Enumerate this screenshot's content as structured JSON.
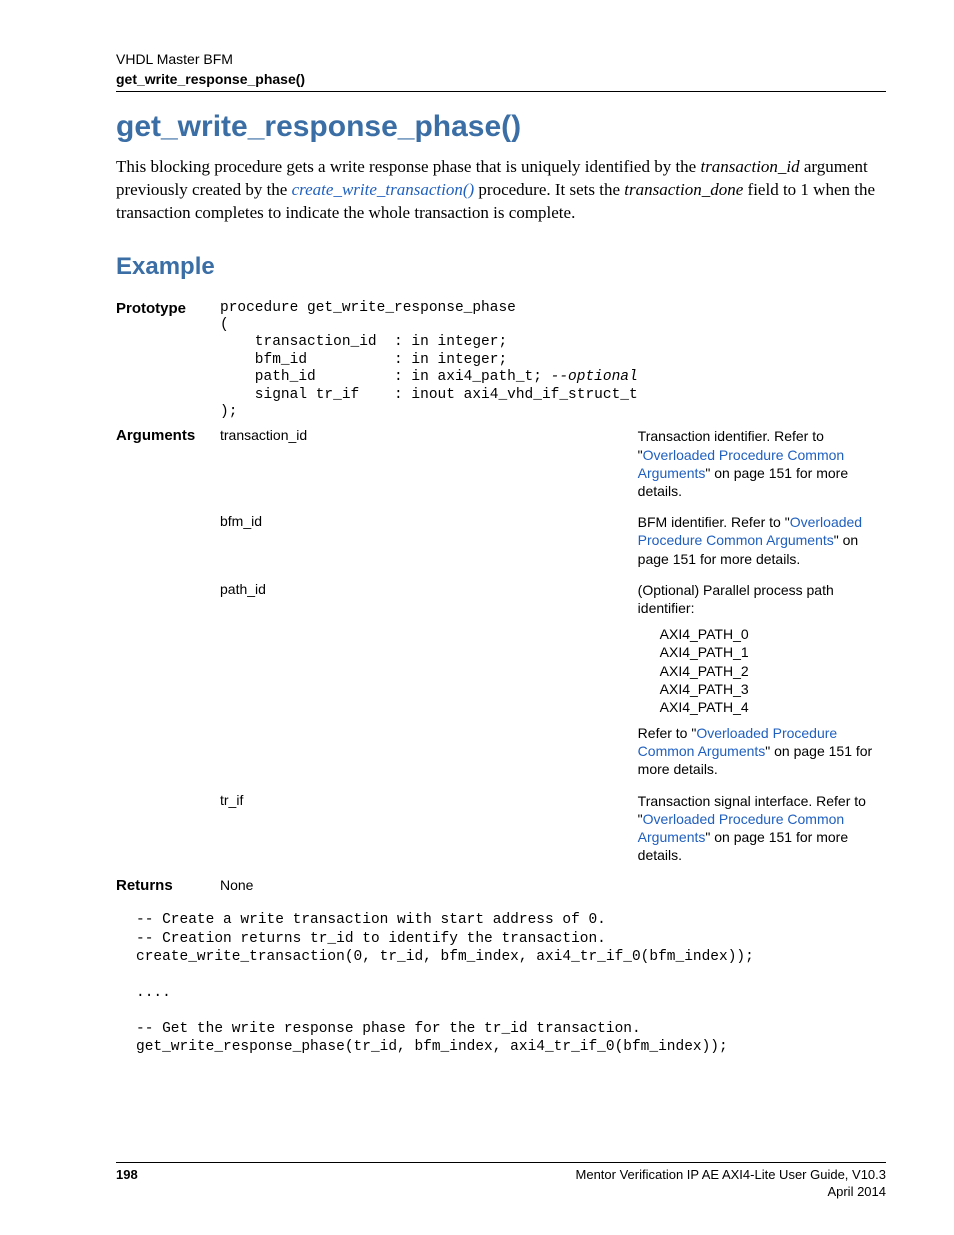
{
  "header": {
    "top": "VHDL Master BFM",
    "sub": "get_write_response_phase()"
  },
  "title": "get_write_response_phase()",
  "intro": {
    "pre": "This blocking procedure gets a write response phase that is uniquely identified by the ",
    "arg_italic": "transaction_id",
    "mid": " argument previously created by the ",
    "link": "create_write_transaction()",
    "post1": " procedure. It sets the ",
    "done_italic": "transaction_done",
    "post2": " field to 1 when the transaction completes to indicate the whole transaction is complete."
  },
  "section_example": "Example",
  "prototype_label": "Prototype",
  "prototype_code": "procedure get_write_response_phase\n(\n    transaction_id  : in integer;\n    bfm_id          : in integer;\n    path_id         : in axi4_path_t; --optional\n    signal tr_if    : inout axi4_vhd_if_struct_t\n);",
  "arguments_label": "Arguments",
  "args": {
    "transaction_id": {
      "name": "transaction_id",
      "pre": "Transaction identifier. Refer to \"",
      "link": "Overloaded Procedure Common Arguments",
      "post": "\" on page 151 for more details."
    },
    "bfm_id": {
      "name": "bfm_id",
      "pre": "BFM identifier. Refer to \"",
      "link": "Overloaded Procedure Common Arguments",
      "post": "\" on page 151 for more details."
    },
    "path_id": {
      "name": "path_id",
      "pre": "(Optional) Parallel process path identifier:",
      "paths": [
        "AXI4_PATH_0",
        "AXI4_PATH_1",
        "AXI4_PATH_2",
        "AXI4_PATH_3",
        "AXI4_PATH_4"
      ],
      "refer_pre": "Refer to \"",
      "refer_link": "Overloaded Procedure Common Arguments",
      "refer_post": "\" on page 151 for more details."
    },
    "tr_if": {
      "name": "tr_if",
      "pre": "Transaction signal interface. Refer to \"",
      "link": "Overloaded Procedure Common Arguments",
      "post": "\" on page 151 for more details."
    }
  },
  "returns_label": "Returns",
  "returns_value": "None",
  "example_code": "-- Create a write transaction with start address of 0.\n-- Creation returns tr_id to identify the transaction.\ncreate_write_transaction(0, tr_id, bfm_index, axi4_tr_if_0(bfm_index));\n\n....\n\n-- Get the write response phase for the tr_id transaction.\nget_write_response_phase(tr_id, bfm_index, axi4_tr_if_0(bfm_index));",
  "footer": {
    "page": "198",
    "guide": "Mentor Verification IP AE AXI4-Lite User Guide, V10.3",
    "date": "April 2014"
  }
}
